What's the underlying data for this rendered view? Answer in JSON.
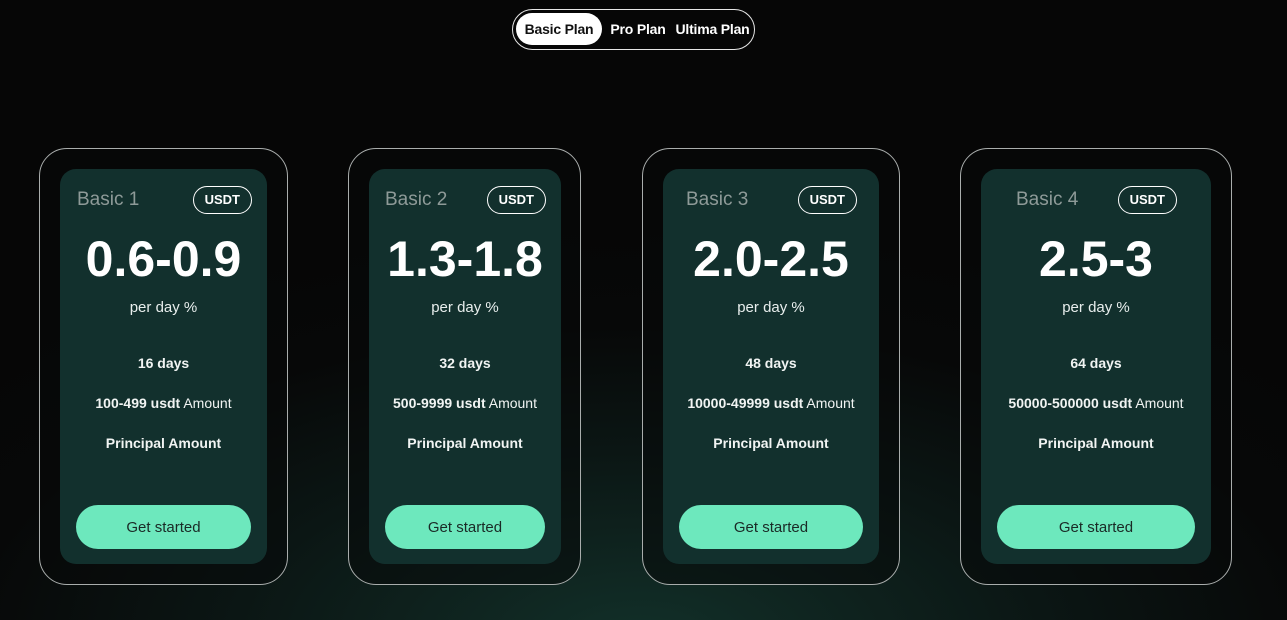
{
  "tabs": [
    {
      "label": "Basic Plan",
      "active": true
    },
    {
      "label": "Pro Plan",
      "active": false
    },
    {
      "label": "Ultima Plan",
      "active": false
    }
  ],
  "plans": [
    {
      "name": "Basic 1",
      "currency": "USDT",
      "rate": "0.6-0.9",
      "rate_unit": "per day %",
      "duration": "16 days",
      "amount_range": "100-499 usdt",
      "amount_suffix": "Amount",
      "principal": "Principal Amount",
      "cta": "Get started"
    },
    {
      "name": "Basic 2",
      "currency": "USDT",
      "rate": "1.3-1.8",
      "rate_unit": "per day %",
      "duration": "32 days",
      "amount_range": "500-9999 usdt",
      "amount_suffix": "Amount",
      "principal": "Principal Amount",
      "cta": "Get started"
    },
    {
      "name": "Basic 3",
      "currency": "USDT",
      "rate": "2.0-2.5",
      "rate_unit": "per day %",
      "duration": "48 days",
      "amount_range": "10000-49999 usdt",
      "amount_suffix": "Amount",
      "principal": "Principal Amount",
      "cta": "Get started"
    },
    {
      "name": "Basic 4",
      "currency": "USDT",
      "rate": "2.5-3",
      "rate_unit": "per day %",
      "duration": "64 days",
      "amount_range": "50000-500000 usdt",
      "amount_suffix": "Amount",
      "principal": "Principal Amount",
      "cta": "Get started"
    }
  ],
  "colors": {
    "accent": "#6de8bd",
    "card_inner": "#12302d",
    "card_border": "#a9adac"
  }
}
